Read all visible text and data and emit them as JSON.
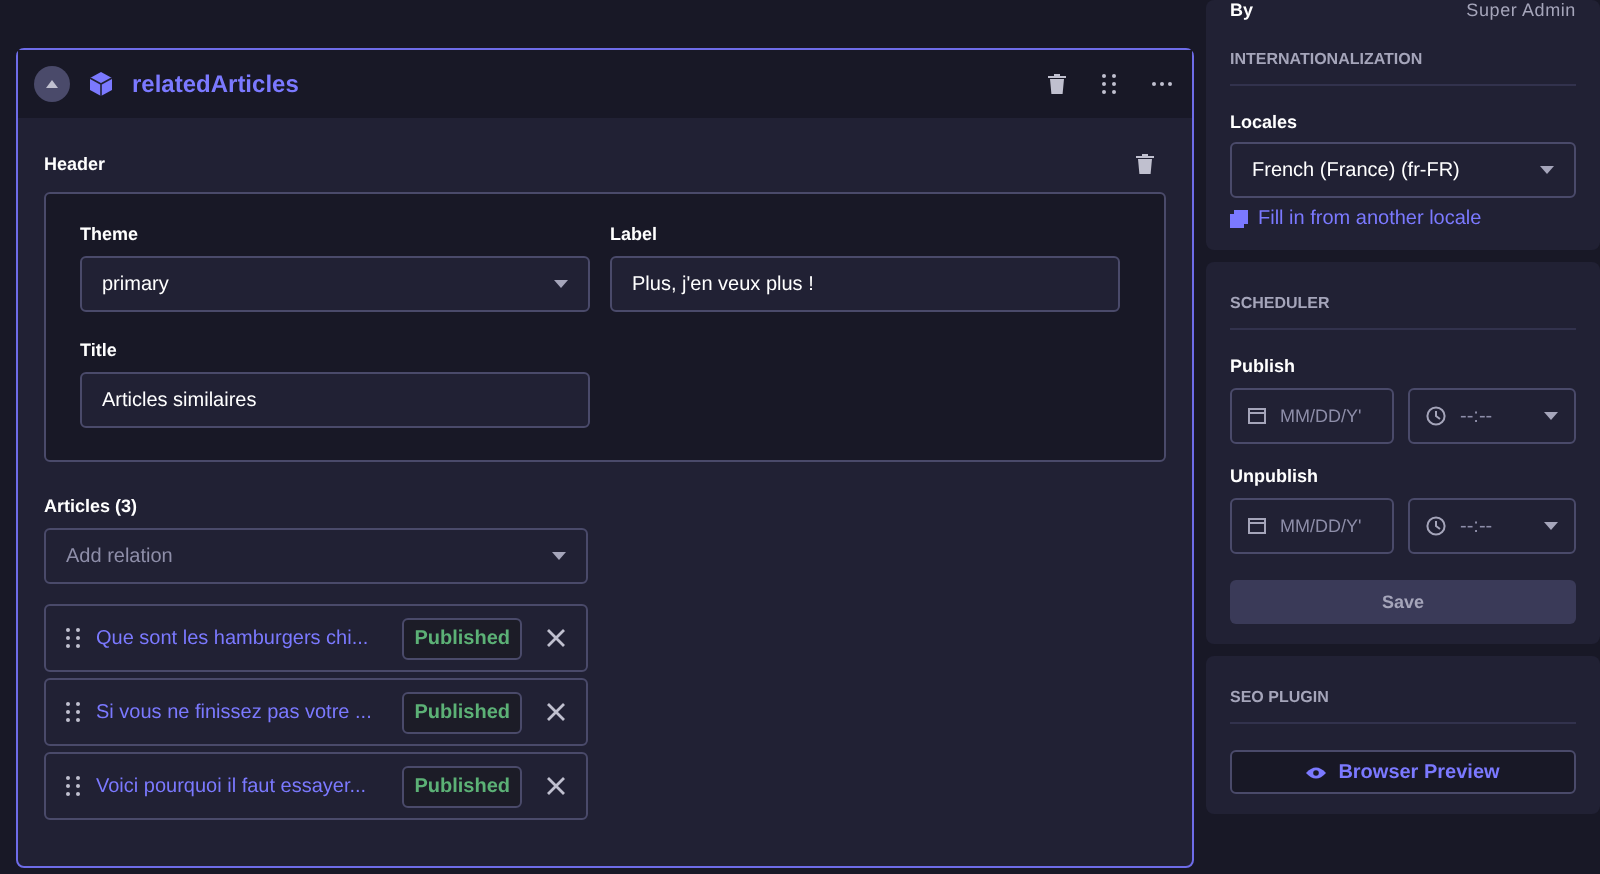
{
  "component": {
    "name": "relatedArticles",
    "expanded": true
  },
  "header": {
    "label": "Header",
    "fields": [
      {
        "label": "Theme",
        "kind": "select",
        "value": "primary"
      },
      {
        "label": "Label",
        "kind": "text",
        "value": "Plus, j'en veux plus !"
      },
      {
        "label": "Title",
        "kind": "text",
        "value": "Articles similaires"
      }
    ]
  },
  "articles": {
    "label": "Articles (3)",
    "placeholder": "Add relation",
    "items": [
      {
        "title": "Que sont les hamburgers chi...",
        "status": "Published"
      },
      {
        "title": "Si vous ne finissez pas votre ...",
        "status": "Published"
      },
      {
        "title": "Voici pourquoi il faut essayer...",
        "status": "Published"
      }
    ]
  },
  "sidebar": {
    "by_label": "By",
    "by_value": "Super Admin",
    "i18n": {
      "heading": "INTERNATIONALIZATION",
      "locales_label": "Locales",
      "locale": "French (France) (fr-FR)",
      "fill_link": "Fill in from another locale"
    },
    "scheduler": {
      "heading": "SCHEDULER",
      "publish_label": "Publish",
      "unpublish_label": "Unpublish",
      "publish_date_placeholder": "MM/DD/Y'",
      "publish_time_placeholder": "--:--",
      "unpublish_date_placeholder": "MM/DD/Y'",
      "unpublish_time_placeholder": "--:--",
      "save": "Save"
    },
    "seo": {
      "heading": "SEO PLUGIN",
      "preview": "Browser Preview"
    }
  }
}
